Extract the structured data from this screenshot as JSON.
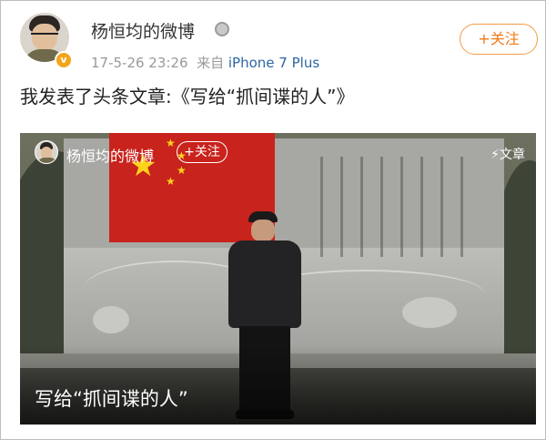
{
  "header": {
    "username": "杨恒均的微博",
    "timestamp": "17-5-26 23:26",
    "source_prefix": "来自",
    "source_device": "iPhone 7 Plus",
    "follow_label": "+关注",
    "verified_badge": "v",
    "medal_icon": "medal-icon"
  },
  "post": {
    "text": "我发表了头条文章:《写给“抓间谍的人”》"
  },
  "card": {
    "username": "杨恒均的微博",
    "follow_label": "+关注",
    "article_label": "文章",
    "article_icon": "lightning-icon",
    "title": "写给“抓间谍的人”"
  },
  "colors": {
    "follow_orange": "#f07a16",
    "source_blue": "#2c67a3",
    "flag_red": "#c8231c"
  }
}
